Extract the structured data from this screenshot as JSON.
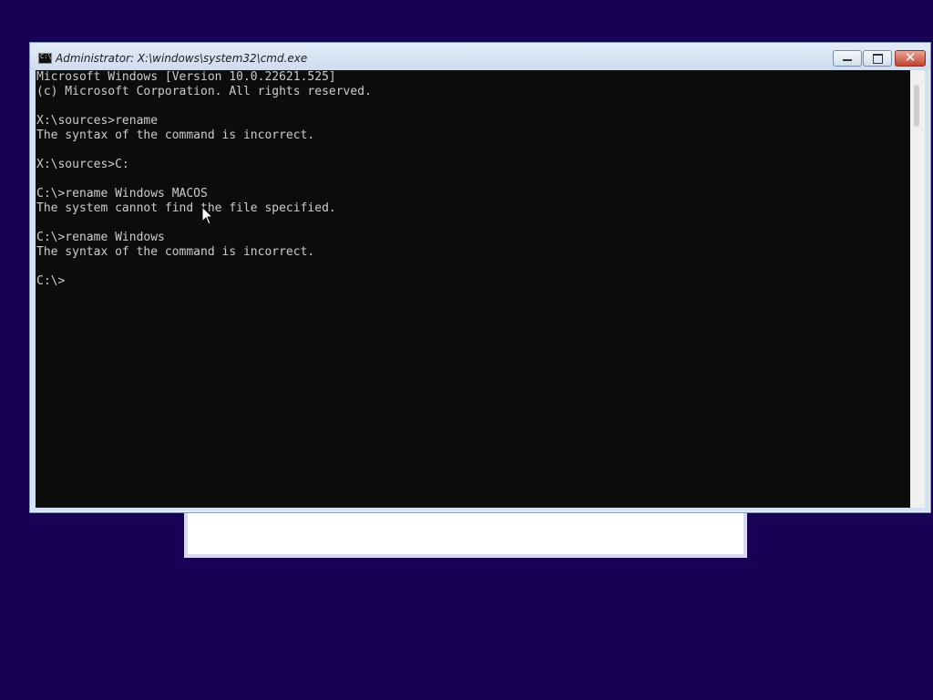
{
  "window": {
    "title": "Administrator: X:\\windows\\system32\\cmd.exe",
    "icon": "cmd-icon"
  },
  "console": {
    "lines": [
      "Microsoft Windows [Version 10.0.22621.525]",
      "(c) Microsoft Corporation. All rights reserved.",
      "",
      "X:\\sources>rename",
      "The syntax of the command is incorrect.",
      "",
      "X:\\sources>C:",
      "",
      "C:\\>rename Windows MACOS",
      "The system cannot find the file specified.",
      "",
      "C:\\>rename Windows",
      "The syntax of the command is incorrect.",
      "",
      "C:\\>"
    ]
  },
  "colors": {
    "desktop_background": "#1a0055",
    "console_background": "#0c0c0c",
    "console_text": "#cccccc",
    "close_button": "#c2432e"
  }
}
